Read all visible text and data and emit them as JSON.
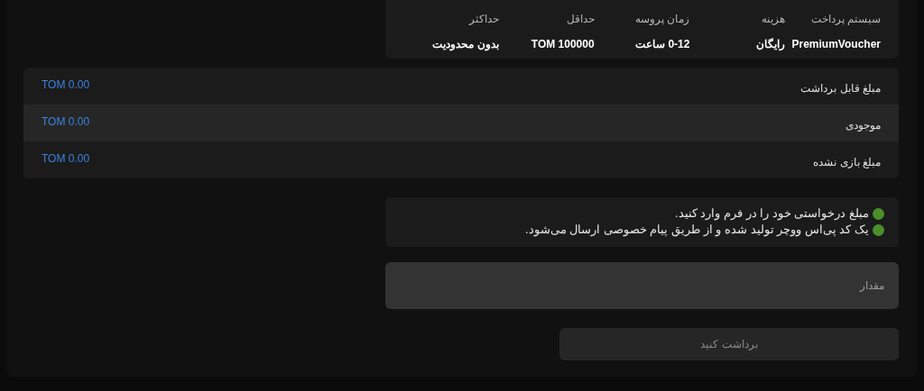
{
  "payment_info": {
    "columns": [
      {
        "header": "سیستم پرداخت",
        "value": "PremiumVoucher"
      },
      {
        "header": "هزینه",
        "value": "رایگان"
      },
      {
        "header": "زمان پروسه",
        "value": "0-12 ساعت"
      },
      {
        "header": "حداقل",
        "value": "TOM 100000"
      },
      {
        "header": "حداکثر",
        "value": "بدون محدودیت"
      }
    ]
  },
  "balances": [
    {
      "label": "مبلغ قابل برداشت",
      "amount": "TOM 0.00"
    },
    {
      "label": "موجودی",
      "amount": "TOM 0.00"
    },
    {
      "label": "مبلغ بازی نشده",
      "amount": "TOM 0.00"
    }
  ],
  "instructions": [
    "مبلغ درخواستی خود را در فرم وارد کنید.",
    "یک کد پی‌اس ووچر تولید شده و از طریق پیام خصوصی ارسال می‌شود."
  ],
  "amount_field": {
    "placeholder": "مقدار"
  },
  "withdraw_button": {
    "label": "برداشت کنید",
    "disabled": true
  }
}
